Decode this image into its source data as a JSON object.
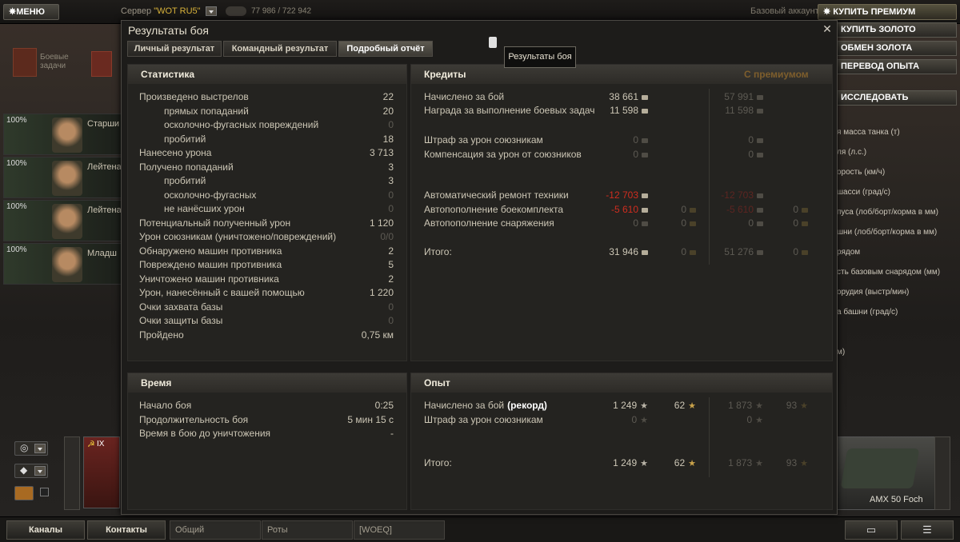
{
  "topbar": {
    "menu_label": "МЕНЮ",
    "server_prefix": "Сервер",
    "server_name": "\"WOT RU5\"",
    "online_count": "77 986 / 722 942",
    "account_type": "Базовый аккаунт",
    "premium_label": "КУПИТЬ ПРЕМИУМ"
  },
  "side_buttons": [
    "КУПИТЬ ЗОЛОТО",
    "ОБМЕН ЗОЛОТА",
    "ПЕРЕВОД ОПЫТА",
    "ИССЛЕДОВАТЬ"
  ],
  "missions": {
    "label": "Боевые задачи"
  },
  "crew": [
    {
      "pct": "100%",
      "rank": "Старши"
    },
    {
      "pct": "100%",
      "rank": "Лейтена"
    },
    {
      "pct": "100%",
      "rank": "Лейтена"
    },
    {
      "pct": "100%",
      "rank": "Младш"
    }
  ],
  "right_params": [
    "я масса танка (т)",
    "ля (л.с.)",
    "орость (км/ч)",
    "шасси (град/с)",
    "пуса (лоб/борт/корма в мм)",
    "шни (лоб/борт/корма в мм)",
    "рядом",
    "сть базовым снарядом (мм)",
    "орудия (выстр/мин)",
    "а башни (град/с)",
    "",
    "м)"
  ],
  "tank": {
    "name": "AMX 50 Foch",
    "left_level": "IX"
  },
  "bottombar": {
    "channels": "Каналы",
    "contacts": "Контакты",
    "tabs": [
      "Общий",
      "Роты",
      "[WOEQ]"
    ]
  },
  "modal": {
    "title": "Результаты боя",
    "tabs": [
      "Личный результат",
      "Командный результат",
      "Подробный отчёт"
    ],
    "active_tab": 2,
    "tooltip": "Результаты боя",
    "statistics": {
      "header": "Статистика",
      "rows": [
        {
          "label": "Произведено выстрелов",
          "value": "22",
          "indent": 0,
          "dim": false
        },
        {
          "label": "прямых попаданий",
          "value": "20",
          "indent": 1,
          "dim": false
        },
        {
          "label": "осколочно-фугасных повреждений",
          "value": "0",
          "indent": 1,
          "dim": true
        },
        {
          "label": "пробитий",
          "value": "18",
          "indent": 1,
          "dim": false
        },
        {
          "label": "Нанесено урона",
          "value": "3 713",
          "indent": 0,
          "dim": false
        },
        {
          "label": "Получено попаданий",
          "value": "3",
          "indent": 0,
          "dim": false
        },
        {
          "label": "пробитий",
          "value": "3",
          "indent": 1,
          "dim": false
        },
        {
          "label": "осколочно-фугасных",
          "value": "0",
          "indent": 1,
          "dim": true
        },
        {
          "label": "не нанёсших урон",
          "value": "0",
          "indent": 1,
          "dim": true
        },
        {
          "label": "Потенциальный полученный урон",
          "value": "1 120",
          "indent": 0,
          "dim": false
        },
        {
          "label": "Урон союзникам (уничтожено/повреждений)",
          "value": "0/0",
          "indent": 0,
          "dim": true
        },
        {
          "label": "Обнаружено машин противника",
          "value": "2",
          "indent": 0,
          "dim": false
        },
        {
          "label": "Повреждено машин противника",
          "value": "5",
          "indent": 0,
          "dim": false
        },
        {
          "label": "Уничтожено машин противника",
          "value": "2",
          "indent": 0,
          "dim": false
        },
        {
          "label": "Урон, нанесённый с вашей помощью",
          "value": "1 220",
          "indent": 0,
          "dim": false
        },
        {
          "label": "Очки захвата базы",
          "value": "0",
          "indent": 0,
          "dim": true
        },
        {
          "label": "Очки защиты базы",
          "value": "0",
          "indent": 0,
          "dim": true
        },
        {
          "label": "Пройдено",
          "value": "0,75 км",
          "indent": 0,
          "dim": false
        }
      ]
    },
    "credits": {
      "header": "Кредиты",
      "premium_header": "С премиумом",
      "rows": [
        {
          "label": "Начислено за бой",
          "cr": "38 661",
          "crdim": false,
          "gold": "",
          "pcr": "57 991",
          "pgold": "",
          "red": false,
          "gap": 0
        },
        {
          "label": "Награда за выполнение боевых задач",
          "cr": "11 598",
          "crdim": false,
          "gold": "",
          "pcr": "11 598",
          "pgold": "",
          "red": false,
          "gap": 0
        },
        {
          "label": "Штраф за урон союзникам",
          "cr": "0",
          "crdim": true,
          "gold": "",
          "pcr": "0",
          "pgold": "",
          "red": false,
          "gap": 1
        },
        {
          "label": "Компенсация за урон от союзников",
          "cr": "0",
          "crdim": true,
          "gold": "",
          "pcr": "0",
          "pgold": "",
          "red": false,
          "gap": 1
        },
        {
          "label": "Автоматический ремонт техники",
          "cr": "-12 703",
          "crdim": false,
          "gold": "",
          "pcr": "-12 703",
          "pgold": "",
          "red": true,
          "gap": 3
        },
        {
          "label": "Автопополнение боекомплекта",
          "cr": "-5 610",
          "crdim": false,
          "gold": "0",
          "pcr": "-5 610",
          "pgold": "0",
          "red": true,
          "gap": 3
        },
        {
          "label": "Автопополнение снаряжения",
          "cr": "0",
          "crdim": true,
          "gold": "0",
          "pcr": "0",
          "pgold": "0",
          "red": false,
          "gap": 3
        },
        {
          "label": "Итого:",
          "cr": "31 946",
          "crdim": false,
          "gold": "0",
          "pcr": "51 276",
          "pgold": "0",
          "red": false,
          "gap": 4
        }
      ]
    },
    "time": {
      "header": "Время",
      "rows": [
        {
          "label": "Начало боя",
          "value": "0:25"
        },
        {
          "label": "Продолжительность боя",
          "value": "5 мин 15 с"
        },
        {
          "label": "Время в бою до уничтожения",
          "value": "-"
        }
      ]
    },
    "experience": {
      "header": "Опыт",
      "rows": [
        {
          "label": "Начислено за бой",
          "label_bold": "(рекорд)",
          "xp": "1 249",
          "free": "62",
          "pxp": "1 873",
          "pfree": "93",
          "xpdim": false
        },
        {
          "label": "Штраф за урон союзникам",
          "label_bold": "",
          "xp": "0",
          "free": "",
          "pxp": "0",
          "pfree": "",
          "xpdim": true
        },
        {
          "label": "Итого:",
          "label_bold": "",
          "xp": "1 249",
          "free": "62",
          "pxp": "1 873",
          "pfree": "93",
          "xpdim": false
        }
      ]
    }
  }
}
